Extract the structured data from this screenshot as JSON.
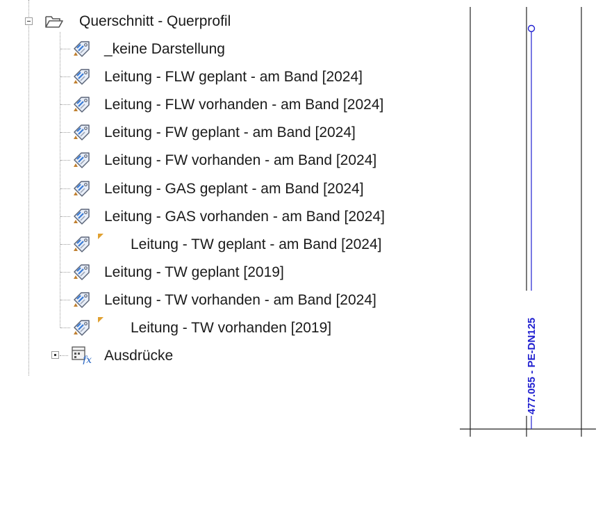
{
  "tree": {
    "root": {
      "label": "Querschnitt - Querprofil",
      "icon": "folder-open-icon"
    },
    "items": [
      {
        "label": "_keine Darstellung",
        "icon": "style-tag-icon",
        "marked": false
      },
      {
        "label": "Leitung - FLW geplant - am Band [2024]",
        "icon": "style-tag-icon",
        "marked": false
      },
      {
        "label": "Leitung - FLW vorhanden - am Band [2024]",
        "icon": "style-tag-icon",
        "marked": false
      },
      {
        "label": "Leitung - FW geplant - am Band [2024]",
        "icon": "style-tag-icon",
        "marked": false
      },
      {
        "label": "Leitung - FW vorhanden - am Band [2024]",
        "icon": "style-tag-icon",
        "marked": false
      },
      {
        "label": "Leitung - GAS geplant - am Band [2024]",
        "icon": "style-tag-icon",
        "marked": false
      },
      {
        "label": "Leitung - GAS vorhanden - am Band [2024]",
        "icon": "style-tag-icon",
        "marked": false
      },
      {
        "label": "Leitung - TW geplant - am Band [2024]",
        "icon": "style-tag-icon",
        "marked": true
      },
      {
        "label": "Leitung - TW geplant [2019]",
        "icon": "style-tag-icon",
        "marked": false
      },
      {
        "label": "Leitung - TW vorhanden - am Band [2024]",
        "icon": "style-tag-icon",
        "marked": false
      },
      {
        "label": "Leitung - TW vorhanden [2019]",
        "icon": "style-tag-icon",
        "marked": true
      }
    ],
    "next": {
      "label": "Ausdrücke",
      "icon": "expression-fx-icon"
    }
  },
  "drawing": {
    "pipe_label": "477.055 - PE-DN125",
    "pipe_color": "#2020d0",
    "line_color": "#222222",
    "marker_color": "#e0a030"
  }
}
